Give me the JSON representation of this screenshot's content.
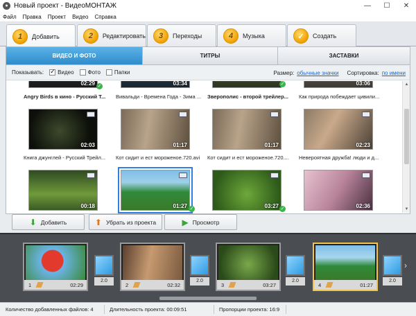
{
  "window": {
    "title": "Новый проект - ВидеоМОНТАЖ",
    "app_icon": "film-reel-icon"
  },
  "menu": [
    "Файл",
    "Правка",
    "Проект",
    "Видео",
    "Справка"
  ],
  "steps": [
    {
      "num": "1",
      "label": "Добавить",
      "active": true
    },
    {
      "num": "2",
      "label": "Редактировать",
      "active": false
    },
    {
      "num": "3",
      "label": "Переходы",
      "active": false
    },
    {
      "num": "4",
      "label": "Музыка",
      "active": false
    },
    {
      "num": "✓",
      "label": "Создать",
      "active": false
    }
  ],
  "subtabs": [
    "ВИДЕО И ФОТО",
    "ТИТРЫ",
    "ЗАСТАВКИ"
  ],
  "filter": {
    "show_label": "Показывать:",
    "options": [
      {
        "label": "Видео",
        "checked": true
      },
      {
        "label": "Фото",
        "checked": false
      },
      {
        "label": "Папки",
        "checked": false
      }
    ],
    "size_label": "Размер:",
    "size_value": "обычные значки",
    "sort_label": "Сортировка:",
    "sort_value": "по имени"
  },
  "top_partial_row": [
    "02:29",
    "03:34",
    "",
    "03:06"
  ],
  "captions_row1": [
    "Angry Birds в кино - Русский Т...",
    "Вивальди - Времена Года - Зима ...",
    "Зверополис - второй трейлер...",
    "Как природа побеждает цивили..."
  ],
  "row2": {
    "durations": [
      "02:03",
      "01:17",
      "01:17",
      "02:23"
    ],
    "captions": [
      "Книга джунглей - Русский Трейл...",
      "Кот сидит и ест мороженое.720.avi",
      "Кот сидит и ест мороженое.720....",
      "Невероятная дружба! люди и д..."
    ]
  },
  "row3": {
    "durations": [
      "00:18",
      "01:27",
      "03:27",
      "02:36"
    ]
  },
  "actions": {
    "add": "Добавить",
    "remove": "Убрать из проекта",
    "preview": "Просмотр"
  },
  "timeline": {
    "clips": [
      {
        "n": "1",
        "time": "02:29"
      },
      {
        "n": "2",
        "time": "02:32"
      },
      {
        "n": "3",
        "time": "03:27"
      },
      {
        "n": "4",
        "time": "01:27"
      }
    ],
    "transitions": [
      "2.0",
      "2.0",
      "2.0",
      "2.0"
    ]
  },
  "status": {
    "files": "Количество добавленных файлов: 4",
    "duration": "Длительность проекта: 00:09:51",
    "ratio": "Пропорции проекта: 16:9"
  },
  "colors": {
    "accent_blue": "#2f8ccb",
    "step_gold": "#f0a000",
    "selected_clip": "#f1c64a"
  }
}
